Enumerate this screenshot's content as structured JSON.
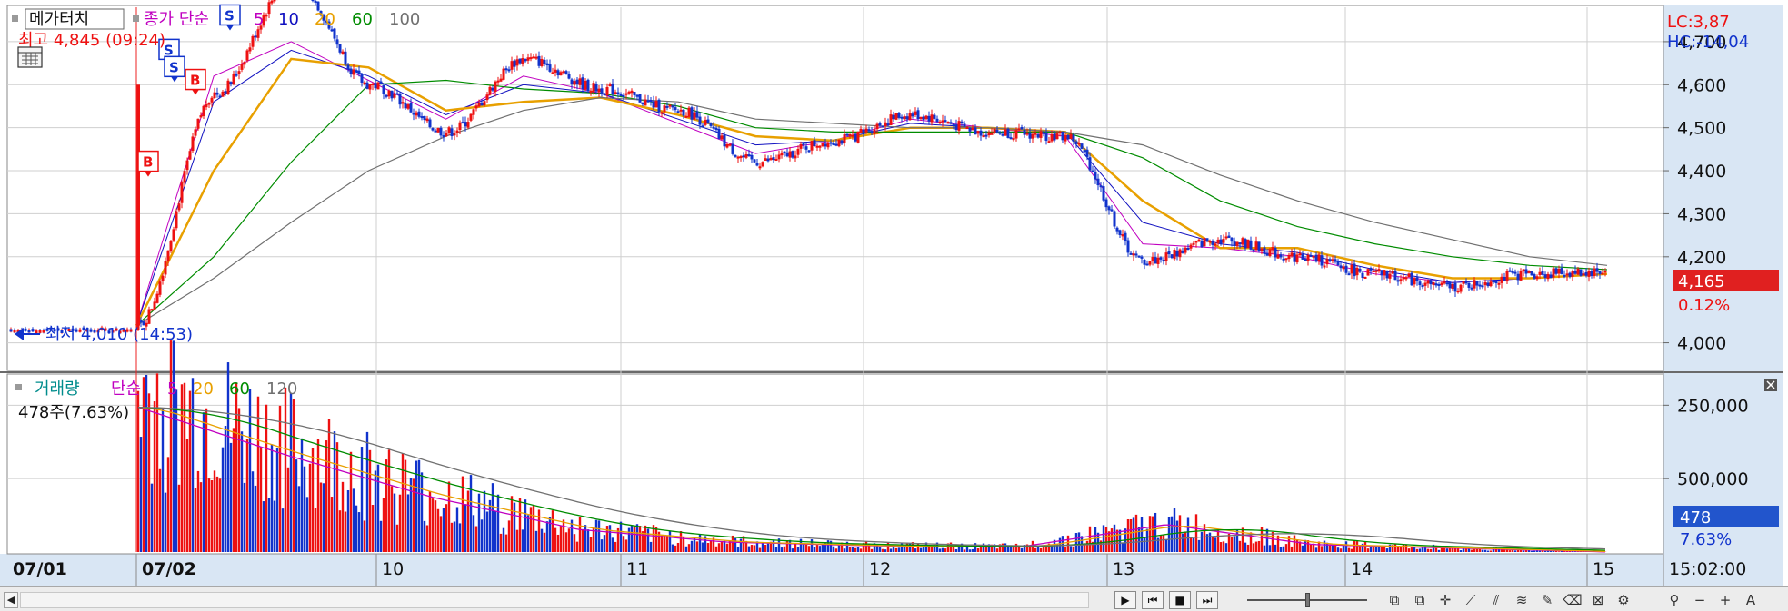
{
  "price_panel": {
    "legend": {
      "title": "메가터치",
      "ma_label": "종가 단순",
      "periods": [
        {
          "label": "5",
          "color": "#c000c0"
        },
        {
          "label": "10",
          "color": "#1010c0"
        },
        {
          "label": "20",
          "color": "#e8a000"
        },
        {
          "label": "60",
          "color": "#008c00"
        },
        {
          "label": "100",
          "color": "#707070"
        }
      ]
    },
    "high_label": "최고 4,845 (09:24)",
    "low_label": "최저 4,010 (14:53)",
    "lc_label": "LC:3,87",
    "hc_label": "HC:-14,04",
    "current_price": "4,165",
    "current_change": "0.12%",
    "yticks": [
      "4,700",
      "4,600",
      "4,500",
      "4,400",
      "4,300",
      "4,200",
      "4,000"
    ]
  },
  "volume_panel": {
    "legend": {
      "title": "거래량",
      "ma_label": "단순",
      "periods": [
        {
          "label": "5",
          "color": "#c000c0"
        },
        {
          "label": "20",
          "color": "#e8a000"
        },
        {
          "label": "60",
          "color": "#008c00"
        },
        {
          "label": "120",
          "color": "#707070"
        }
      ]
    },
    "current_label": "478주(7.63%)",
    "current_volume": "478",
    "current_pct": "7.63%",
    "yticks": [
      "500,000",
      "250,000"
    ]
  },
  "xaxis": {
    "labels": [
      "07/01",
      "07/02",
      "10",
      "11",
      "12",
      "13",
      "14",
      "15"
    ],
    "time_label": "15:02:00"
  },
  "markers": [
    "B",
    "S",
    "S",
    "B",
    "S"
  ],
  "colors": {
    "up": "#ee1111",
    "down": "#1133cc",
    "ma5": "#c000c0",
    "ma10": "#1010c0",
    "ma20": "#e8a000",
    "ma60": "#008c00",
    "ma100": "#707070",
    "price_badge": "#e02020",
    "volume_badge": "#2255cc",
    "axis_bg": "#d9e6f4"
  },
  "chart_data": {
    "type": "candlestick",
    "title": "메가터치",
    "sessions": [
      "07/01",
      "07/02",
      "10",
      "11",
      "12",
      "13",
      "14",
      "15"
    ],
    "ylim": [
      3940,
      4780
    ],
    "y_unit": "KRW",
    "price_path": [
      {
        "t": "07/01",
        "price": 4030
      },
      {
        "t": "07/02 open",
        "price": 4040
      },
      {
        "t": "07/02 early",
        "price": 4580
      },
      {
        "t": "07/02 09:24 high",
        "price": 4845
      },
      {
        "t": "07/02 late",
        "price": 4600
      },
      {
        "t": "10 early",
        "price": 4490
      },
      {
        "t": "10 mid",
        "price": 4660
      },
      {
        "t": "10 late",
        "price": 4590
      },
      {
        "t": "11 early",
        "price": 4540
      },
      {
        "t": "11 mid",
        "price": 4420
      },
      {
        "t": "11 late",
        "price": 4470
      },
      {
        "t": "12 early",
        "price": 4530
      },
      {
        "t": "12 mid",
        "price": 4490
      },
      {
        "t": "12 late",
        "price": 4480
      },
      {
        "t": "13 early",
        "price": 4190
      },
      {
        "t": "13 mid",
        "price": 4240
      },
      {
        "t": "13 late",
        "price": 4200
      },
      {
        "t": "14 early",
        "price": 4160
      },
      {
        "t": "14 mid",
        "price": 4130
      },
      {
        "t": "14 late",
        "price": 4160
      },
      {
        "t": "15",
        "price": 4165
      }
    ],
    "high": {
      "value": 4845,
      "time": "09:24"
    },
    "low": {
      "value": 4010,
      "time": "14:53"
    },
    "last": 4165,
    "series": [
      {
        "name": "5",
        "values": [
          4040,
          4620,
          4700,
          4610,
          4520,
          4620,
          4580,
          4510,
          4440,
          4470,
          4520,
          4500,
          4480,
          4230,
          4220,
          4200,
          4160,
          4140,
          4150,
          4160
        ]
      },
      {
        "name": "10",
        "values": [
          4040,
          4560,
          4680,
          4620,
          4530,
          4600,
          4580,
          4520,
          4460,
          4470,
          4510,
          4500,
          4490,
          4280,
          4230,
          4210,
          4170,
          4140,
          4150,
          4160
        ]
      },
      {
        "name": "20",
        "values": [
          4040,
          4400,
          4660,
          4640,
          4540,
          4560,
          4570,
          4530,
          4480,
          4470,
          4500,
          4500,
          4490,
          4330,
          4220,
          4220,
          4180,
          4150,
          4150,
          4160
        ]
      },
      {
        "name": "60",
        "values": [
          4040,
          4200,
          4420,
          4600,
          4610,
          4590,
          4580,
          4550,
          4500,
          4490,
          4490,
          4490,
          4490,
          4430,
          4330,
          4270,
          4230,
          4200,
          4180,
          4170
        ]
      },
      {
        "name": "100",
        "values": [
          4040,
          4150,
          4280,
          4400,
          4480,
          4540,
          4570,
          4560,
          4520,
          4510,
          4500,
          4500,
          4490,
          4460,
          4390,
          4330,
          4280,
          4240,
          4200,
          4180
        ]
      }
    ],
    "volume": {
      "ylim": [
        0,
        600000
      ],
      "yticks": [
        250000,
        500000
      ],
      "last": 478,
      "last_pct": "7.63%",
      "profile": [
        {
          "t": "07/02 open",
          "value": 580000
        },
        {
          "t": "07/02 early",
          "value": 390000
        },
        {
          "t": "07/02 mid",
          "value": 220000
        },
        {
          "t": "07/02 late",
          "value": 90000
        },
        {
          "t": "10",
          "value": 40000
        },
        {
          "t": "11",
          "value": 25000
        },
        {
          "t": "12",
          "value": 20000
        },
        {
          "t": "13 open",
          "value": 110000
        },
        {
          "t": "13",
          "value": 30000
        },
        {
          "t": "14",
          "value": 15000
        },
        {
          "t": "15",
          "value": 478
        }
      ]
    }
  }
}
